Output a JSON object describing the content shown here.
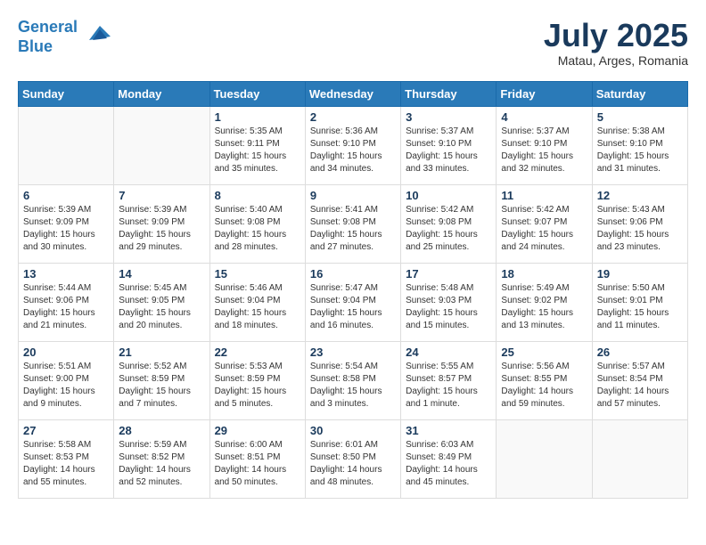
{
  "header": {
    "logo_line1": "General",
    "logo_line2": "Blue",
    "month_title": "July 2025",
    "location": "Matau, Arges, Romania"
  },
  "days_of_week": [
    "Sunday",
    "Monday",
    "Tuesday",
    "Wednesday",
    "Thursday",
    "Friday",
    "Saturday"
  ],
  "weeks": [
    [
      {
        "num": "",
        "info": ""
      },
      {
        "num": "",
        "info": ""
      },
      {
        "num": "1",
        "info": "Sunrise: 5:35 AM\nSunset: 9:11 PM\nDaylight: 15 hours and 35 minutes."
      },
      {
        "num": "2",
        "info": "Sunrise: 5:36 AM\nSunset: 9:10 PM\nDaylight: 15 hours and 34 minutes."
      },
      {
        "num": "3",
        "info": "Sunrise: 5:37 AM\nSunset: 9:10 PM\nDaylight: 15 hours and 33 minutes."
      },
      {
        "num": "4",
        "info": "Sunrise: 5:37 AM\nSunset: 9:10 PM\nDaylight: 15 hours and 32 minutes."
      },
      {
        "num": "5",
        "info": "Sunrise: 5:38 AM\nSunset: 9:10 PM\nDaylight: 15 hours and 31 minutes."
      }
    ],
    [
      {
        "num": "6",
        "info": "Sunrise: 5:39 AM\nSunset: 9:09 PM\nDaylight: 15 hours and 30 minutes."
      },
      {
        "num": "7",
        "info": "Sunrise: 5:39 AM\nSunset: 9:09 PM\nDaylight: 15 hours and 29 minutes."
      },
      {
        "num": "8",
        "info": "Sunrise: 5:40 AM\nSunset: 9:08 PM\nDaylight: 15 hours and 28 minutes."
      },
      {
        "num": "9",
        "info": "Sunrise: 5:41 AM\nSunset: 9:08 PM\nDaylight: 15 hours and 27 minutes."
      },
      {
        "num": "10",
        "info": "Sunrise: 5:42 AM\nSunset: 9:08 PM\nDaylight: 15 hours and 25 minutes."
      },
      {
        "num": "11",
        "info": "Sunrise: 5:42 AM\nSunset: 9:07 PM\nDaylight: 15 hours and 24 minutes."
      },
      {
        "num": "12",
        "info": "Sunrise: 5:43 AM\nSunset: 9:06 PM\nDaylight: 15 hours and 23 minutes."
      }
    ],
    [
      {
        "num": "13",
        "info": "Sunrise: 5:44 AM\nSunset: 9:06 PM\nDaylight: 15 hours and 21 minutes."
      },
      {
        "num": "14",
        "info": "Sunrise: 5:45 AM\nSunset: 9:05 PM\nDaylight: 15 hours and 20 minutes."
      },
      {
        "num": "15",
        "info": "Sunrise: 5:46 AM\nSunset: 9:04 PM\nDaylight: 15 hours and 18 minutes."
      },
      {
        "num": "16",
        "info": "Sunrise: 5:47 AM\nSunset: 9:04 PM\nDaylight: 15 hours and 16 minutes."
      },
      {
        "num": "17",
        "info": "Sunrise: 5:48 AM\nSunset: 9:03 PM\nDaylight: 15 hours and 15 minutes."
      },
      {
        "num": "18",
        "info": "Sunrise: 5:49 AM\nSunset: 9:02 PM\nDaylight: 15 hours and 13 minutes."
      },
      {
        "num": "19",
        "info": "Sunrise: 5:50 AM\nSunset: 9:01 PM\nDaylight: 15 hours and 11 minutes."
      }
    ],
    [
      {
        "num": "20",
        "info": "Sunrise: 5:51 AM\nSunset: 9:00 PM\nDaylight: 15 hours and 9 minutes."
      },
      {
        "num": "21",
        "info": "Sunrise: 5:52 AM\nSunset: 8:59 PM\nDaylight: 15 hours and 7 minutes."
      },
      {
        "num": "22",
        "info": "Sunrise: 5:53 AM\nSunset: 8:59 PM\nDaylight: 15 hours and 5 minutes."
      },
      {
        "num": "23",
        "info": "Sunrise: 5:54 AM\nSunset: 8:58 PM\nDaylight: 15 hours and 3 minutes."
      },
      {
        "num": "24",
        "info": "Sunrise: 5:55 AM\nSunset: 8:57 PM\nDaylight: 15 hours and 1 minute."
      },
      {
        "num": "25",
        "info": "Sunrise: 5:56 AM\nSunset: 8:55 PM\nDaylight: 14 hours and 59 minutes."
      },
      {
        "num": "26",
        "info": "Sunrise: 5:57 AM\nSunset: 8:54 PM\nDaylight: 14 hours and 57 minutes."
      }
    ],
    [
      {
        "num": "27",
        "info": "Sunrise: 5:58 AM\nSunset: 8:53 PM\nDaylight: 14 hours and 55 minutes."
      },
      {
        "num": "28",
        "info": "Sunrise: 5:59 AM\nSunset: 8:52 PM\nDaylight: 14 hours and 52 minutes."
      },
      {
        "num": "29",
        "info": "Sunrise: 6:00 AM\nSunset: 8:51 PM\nDaylight: 14 hours and 50 minutes."
      },
      {
        "num": "30",
        "info": "Sunrise: 6:01 AM\nSunset: 8:50 PM\nDaylight: 14 hours and 48 minutes."
      },
      {
        "num": "31",
        "info": "Sunrise: 6:03 AM\nSunset: 8:49 PM\nDaylight: 14 hours and 45 minutes."
      },
      {
        "num": "",
        "info": ""
      },
      {
        "num": "",
        "info": ""
      }
    ]
  ]
}
